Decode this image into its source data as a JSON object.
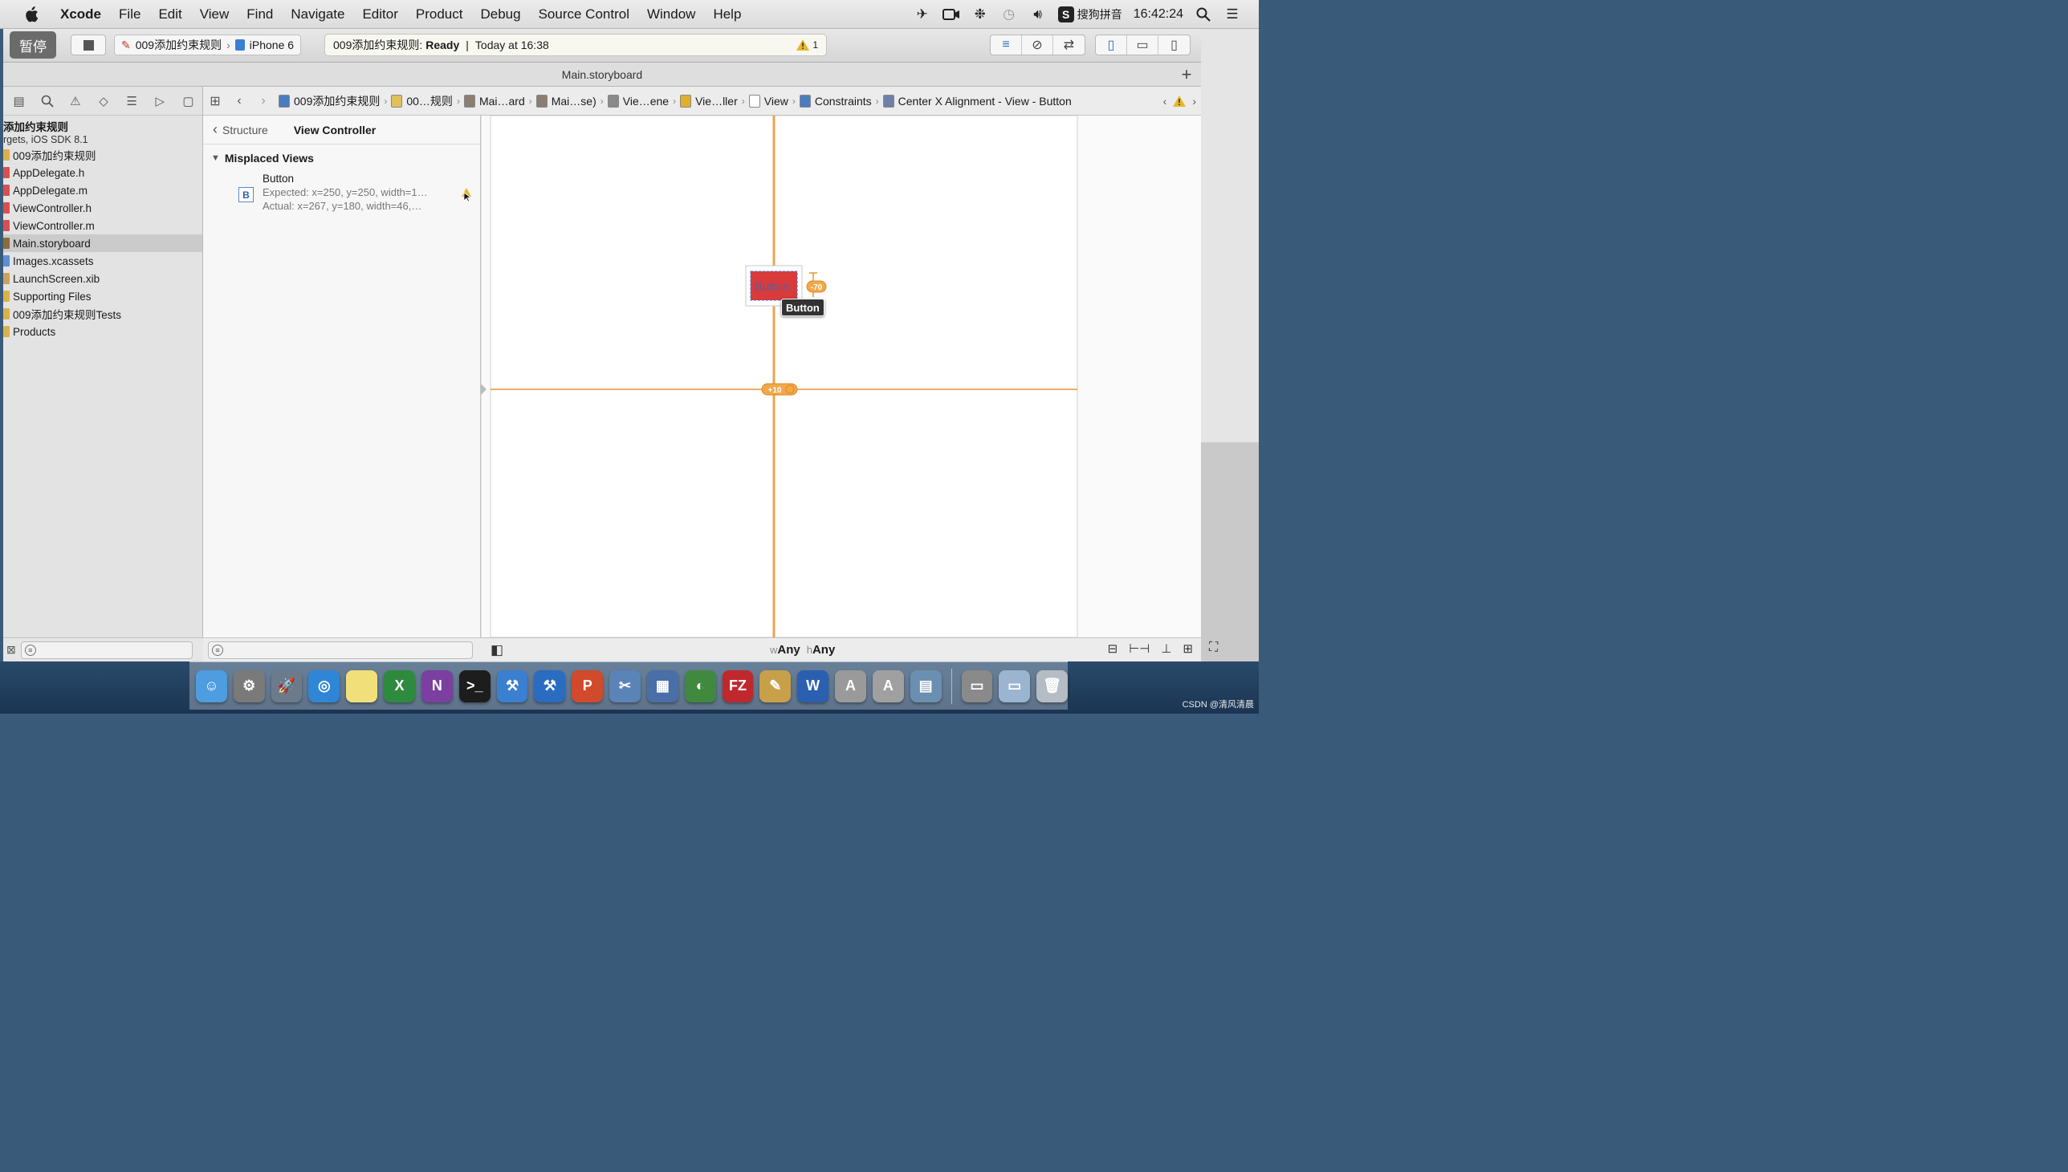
{
  "menubar": {
    "app_name": "Xcode",
    "items": [
      "File",
      "Edit",
      "View",
      "Find",
      "Navigate",
      "Editor",
      "Product",
      "Debug",
      "Source Control",
      "Window",
      "Help"
    ],
    "ime_label": "搜狗拼音",
    "time": "16:42:24"
  },
  "toolbar": {
    "pause_badge": "暂停",
    "scheme_name": "009添加约束规则",
    "device": "iPhone 6",
    "status_project": "009添加约束规则:",
    "status_state": "Ready",
    "status_divider": "|",
    "status_time": "Today at 16:38",
    "warning_count": "1"
  },
  "tab": {
    "title": "Main.storyboard"
  },
  "navigator": {
    "project_name": "添加约束规则",
    "project_sub": "rgets, iOS SDK 8.1",
    "items": [
      {
        "label": "009添加约束规则",
        "color": "#d9b24a"
      },
      {
        "label": "AppDelegate.h",
        "color": "#d94f4f"
      },
      {
        "label": "AppDelegate.m",
        "color": "#d94f4f"
      },
      {
        "label": "ViewController.h",
        "color": "#d94f4f"
      },
      {
        "label": "ViewController.m",
        "color": "#d94f4f"
      },
      {
        "label": "Main.storyboard",
        "color": "#8a6d3b"
      },
      {
        "label": "Images.xcassets",
        "color": "#5d8fd0"
      },
      {
        "label": "LaunchScreen.xib",
        "color": "#c7a35b"
      },
      {
        "label": "Supporting Files",
        "color": "#d9b24a"
      },
      {
        "label": "009添加约束规则Tests",
        "color": "#d9b24a"
      },
      {
        "label": "Products",
        "color": "#d9b24a"
      }
    ],
    "selected_index": 5
  },
  "jumpbar": {
    "crumbs": [
      {
        "label": "009添加约束规则",
        "color": "#4a7cc0"
      },
      {
        "label": "00…规则",
        "color": "#e2c05a"
      },
      {
        "label": "Mai…ard",
        "color": "#8a7f70"
      },
      {
        "label": "Mai…se)",
        "color": "#8a7f70"
      },
      {
        "label": "Vie…ene",
        "color": "#8a8a8a"
      },
      {
        "label": "Vie…ller",
        "color": "#e0b02c"
      },
      {
        "label": "View",
        "color": "#ffffff"
      },
      {
        "label": "Constraints",
        "color": "#4a7cc0"
      },
      {
        "label": "Center X Alignment - View - Button",
        "color": "#6e7fa8"
      }
    ]
  },
  "issues": {
    "back_label": "Structure",
    "title": "View Controller",
    "section": "Misplaced Views",
    "item": {
      "icon_letter": "B",
      "name": "Button",
      "expected": "Expected: x=250, y=250, width=1…",
      "actual": "Actual: x=267, y=180, width=46,…"
    }
  },
  "canvas": {
    "button_label": "Button",
    "tooltip": "Button",
    "badge_offset_top": "-70",
    "badge_center": "+10",
    "guide_color": "#e8952f"
  },
  "canvas_bottom": {
    "w_prefix": "w",
    "w_value": "Any",
    "h_prefix": "h",
    "h_value": "Any"
  },
  "dock": {
    "apps": [
      {
        "name": "finder-icon",
        "color": "#4d9de0",
        "glyph": "☺"
      },
      {
        "name": "system-preferences-icon",
        "color": "#7a7a7a",
        "glyph": "⚙"
      },
      {
        "name": "launchpad-icon",
        "color": "#6b7b8c",
        "glyph": "🚀"
      },
      {
        "name": "safari-icon",
        "color": "#2f86d6",
        "glyph": "◎"
      },
      {
        "name": "notes-icon",
        "color": "#f1e07a",
        "glyph": ""
      },
      {
        "name": "excel-icon",
        "color": "#2e8b3e",
        "glyph": "X"
      },
      {
        "name": "onenote-icon",
        "color": "#7b3fa0",
        "glyph": "N"
      },
      {
        "name": "terminal-icon",
        "color": "#1d1d1d",
        "glyph": ">_"
      },
      {
        "name": "xcode-icon",
        "color": "#3a7fd0",
        "glyph": "⚒"
      },
      {
        "name": "xcode-beta-icon",
        "color": "#2a6cc0",
        "glyph": "⚒"
      },
      {
        "name": "powerpoint-icon",
        "color": "#d14a2b",
        "glyph": "P"
      },
      {
        "name": "screenshot-icon",
        "color": "#5a84b8",
        "glyph": "✂"
      },
      {
        "name": "keynote-icon",
        "color": "#4a6fa8",
        "glyph": "▦"
      },
      {
        "name": "network-icon",
        "color": "#3f8a3f",
        "glyph": "◐"
      },
      {
        "name": "filezilla-icon",
        "color": "#c0282d",
        "glyph": "FZ"
      },
      {
        "name": "utility-icon",
        "color": "#c8a04a",
        "glyph": "✎"
      },
      {
        "name": "word-icon",
        "color": "#2b5fb0",
        "glyph": "W"
      },
      {
        "name": "instruments-icon",
        "color": "#9a9a9a",
        "glyph": "A"
      },
      {
        "name": "instruments2-icon",
        "color": "#a0a0a0",
        "glyph": "A"
      },
      {
        "name": "preview-icon",
        "color": "#6b8fb0",
        "glyph": "▤"
      }
    ],
    "extras": [
      {
        "name": "desktop-icon",
        "color": "#8a8a8a",
        "glyph": "▭"
      },
      {
        "name": "downloads-icon",
        "color": "#9bb4d0",
        "glyph": "▭"
      },
      {
        "name": "trash-icon",
        "color": "#b5bcc4",
        "glyph": "🗑"
      }
    ]
  },
  "watermark": "CSDN @清风清晨"
}
